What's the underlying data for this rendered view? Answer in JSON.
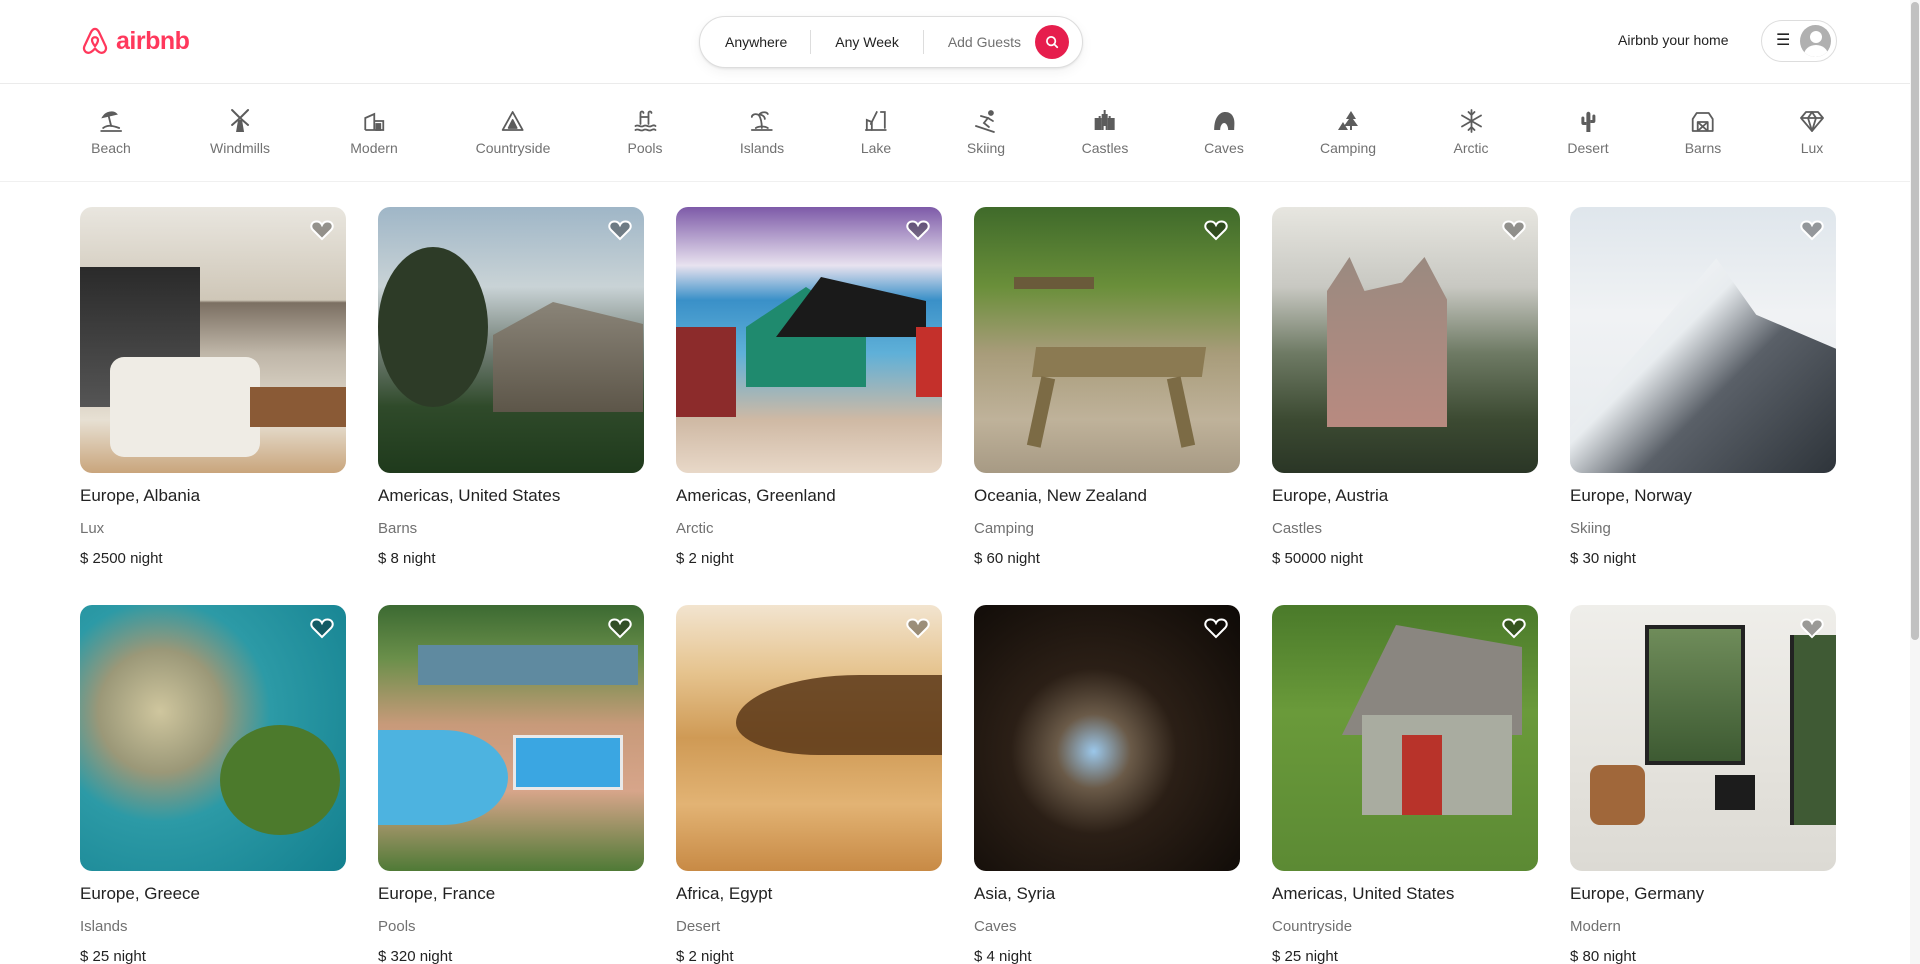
{
  "brand": {
    "name": "airbnb",
    "color": "#ff385c"
  },
  "search": {
    "where": "Anywhere",
    "when": "Any Week",
    "who": "Add Guests",
    "button_color": "#e61e4d"
  },
  "header": {
    "host_link": "Airbnb your home",
    "menu_icon": "hamburger-menu-icon"
  },
  "categories": [
    {
      "label": "Beach",
      "icon": "beach-icon"
    },
    {
      "label": "Windmills",
      "icon": "windmill-icon"
    },
    {
      "label": "Modern",
      "icon": "modern-house-icon"
    },
    {
      "label": "Countryside",
      "icon": "countryside-icon"
    },
    {
      "label": "Pools",
      "icon": "pool-icon"
    },
    {
      "label": "Islands",
      "icon": "island-icon"
    },
    {
      "label": "Lake",
      "icon": "lake-icon"
    },
    {
      "label": "Skiing",
      "icon": "skiing-icon"
    },
    {
      "label": "Castles",
      "icon": "castle-icon"
    },
    {
      "label": "Caves",
      "icon": "cave-icon"
    },
    {
      "label": "Camping",
      "icon": "camping-icon"
    },
    {
      "label": "Arctic",
      "icon": "snowflake-icon"
    },
    {
      "label": "Desert",
      "icon": "cactus-icon"
    },
    {
      "label": "Barns",
      "icon": "barn-icon"
    },
    {
      "label": "Lux",
      "icon": "diamond-icon"
    }
  ],
  "price_unit": "night",
  "listings": [
    {
      "location": "Europe, Albania",
      "category": "Lux",
      "price": "$ 2500"
    },
    {
      "location": "Americas, United States",
      "category": "Barns",
      "price": "$ 8"
    },
    {
      "location": "Americas, Greenland",
      "category": "Arctic",
      "price": "$ 2"
    },
    {
      "location": "Oceania, New Zealand",
      "category": "Camping",
      "price": "$ 60"
    },
    {
      "location": "Europe, Austria",
      "category": "Castles",
      "price": "$ 50000"
    },
    {
      "location": "Europe, Norway",
      "category": "Skiing",
      "price": "$ 30"
    },
    {
      "location": "Europe, Greece",
      "category": "Islands",
      "price": "$ 25"
    },
    {
      "location": "Europe, France",
      "category": "Pools",
      "price": "$ 320"
    },
    {
      "location": "Africa, Egypt",
      "category": "Desert",
      "price": "$ 2"
    },
    {
      "location": "Asia, Syria",
      "category": "Caves",
      "price": "$ 4"
    },
    {
      "location": "Americas, United States",
      "category": "Countryside",
      "price": "$ 25"
    },
    {
      "location": "Europe, Germany",
      "category": "Modern",
      "price": "$ 80"
    }
  ]
}
